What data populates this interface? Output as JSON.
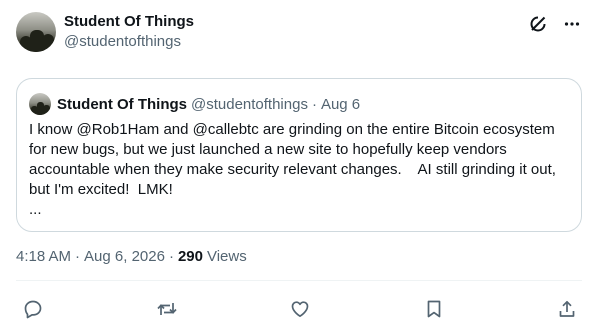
{
  "post": {
    "author_name": "Student Of Things",
    "author_handle": "@studentofthings",
    "header_icons": [
      "grok-icon",
      "more-icon"
    ]
  },
  "quote": {
    "author_name": "Student Of Things",
    "author_handle": "@studentofthings",
    "dot": "·",
    "date": "Aug 6",
    "text": "I know @Rob1Ham and @callebtc are grinding on the entire Bitcoin ecosystem for new bugs, but we just launched a new site to hopefully keep vendors accountable when they make security relevant changes.    AI still grinding it out, but I'm excited!  LMK!",
    "more": "..."
  },
  "meta": {
    "time": "4:18 AM",
    "dot1": "·",
    "date": "Aug 6, 2026",
    "dot2": "·",
    "views_count": "290",
    "views_label": "Views"
  },
  "actions": [
    "reply-icon",
    "repost-icon",
    "like-icon",
    "bookmark-icon",
    "share-icon"
  ],
  "colors": {
    "text": "#0f1419",
    "secondary": "#536471",
    "border": "#cfd9de"
  }
}
